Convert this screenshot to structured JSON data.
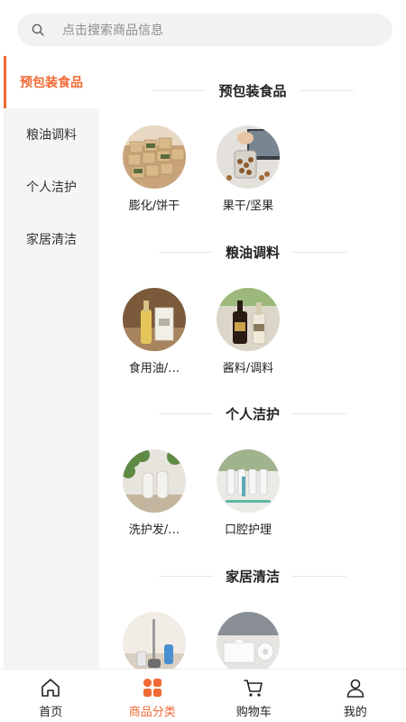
{
  "search": {
    "placeholder": "点击搜索商品信息",
    "icon": "search-icon"
  },
  "sidebar": {
    "items": [
      {
        "label": "预包装食品",
        "active": true
      },
      {
        "label": "粮油调料",
        "active": false
      },
      {
        "label": "个人洁护",
        "active": false
      },
      {
        "label": "家居清洁",
        "active": false
      }
    ]
  },
  "sections": [
    {
      "title": "预包装食品",
      "items": [
        {
          "label": "膨化/饼干"
        },
        {
          "label": "果干/坚果"
        }
      ]
    },
    {
      "title": "粮油调料",
      "items": [
        {
          "label": "食用油/…"
        },
        {
          "label": "酱料/调料"
        }
      ]
    },
    {
      "title": "个人洁护",
      "items": [
        {
          "label": "洗护发/…"
        },
        {
          "label": "口腔护理"
        }
      ]
    },
    {
      "title": "家居清洁",
      "items": [
        {
          "label": ""
        },
        {
          "label": ""
        }
      ]
    }
  ],
  "tabbar": {
    "tabs": [
      {
        "label": "首页",
        "icon": "home-icon",
        "active": false
      },
      {
        "label": "商品分类",
        "icon": "category-icon",
        "active": true
      },
      {
        "label": "购物车",
        "icon": "cart-icon",
        "active": false
      },
      {
        "label": "我的",
        "icon": "user-icon",
        "active": false
      }
    ]
  },
  "colors": {
    "accent": "#f06a35",
    "sidebar_bg": "#f5f5f5",
    "search_bg": "#f2f2f2"
  }
}
